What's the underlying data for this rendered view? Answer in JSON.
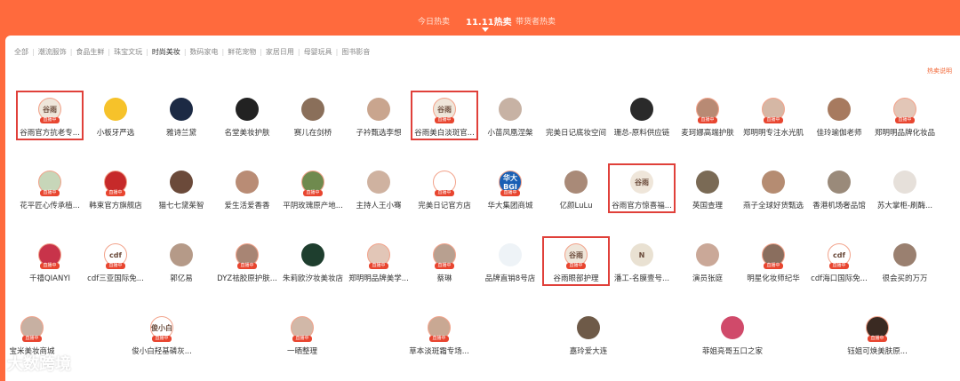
{
  "topnav": {
    "tabs": [
      {
        "label": "今日热卖",
        "active": false
      },
      {
        "label": "11.11热卖",
        "active": true
      },
      {
        "label": "带货者热卖",
        "active": false
      }
    ]
  },
  "categories": [
    {
      "label": "全部",
      "active": false
    },
    {
      "label": "潮流服饰",
      "active": false
    },
    {
      "label": "食品生鲜",
      "active": false
    },
    {
      "label": "珠宝文玩",
      "active": false
    },
    {
      "label": "时尚美妆",
      "active": true
    },
    {
      "label": "数码家电",
      "active": false
    },
    {
      "label": "鲜花宠物",
      "active": false
    },
    {
      "label": "家居日用",
      "active": false
    },
    {
      "label": "母婴玩具",
      "active": false
    },
    {
      "label": "图书影音",
      "active": false
    }
  ],
  "hint": "热卖说明",
  "live_badge": "直播中",
  "watermark": "大数跨境",
  "rows": [
    [
      {
        "name": "谷雨官方抗老专...",
        "avatar": "谷雨",
        "live": true,
        "color": "#efe6da",
        "highlight": true
      },
      {
        "name": "小板牙严选",
        "avatar": "",
        "live": false,
        "color": "#f6c22a"
      },
      {
        "name": "雅诗兰黛",
        "avatar": "",
        "live": false,
        "color": "#1c2a44"
      },
      {
        "name": "名堂美妆护肤",
        "avatar": "",
        "live": false,
        "color": "#222"
      },
      {
        "name": "赛儿在剑桥",
        "avatar": "",
        "live": false,
        "color": "#8a6f5a"
      },
      {
        "name": "子衿甄选李想",
        "avatar": "",
        "live": false,
        "color": "#c9a58e"
      },
      {
        "name": "谷雨美白淡斑官...",
        "avatar": "谷雨",
        "live": true,
        "color": "#efe6da",
        "highlight": true
      },
      {
        "name": "小苗凤凰涅槃",
        "avatar": "",
        "live": false,
        "color": "#c7b2a4"
      },
      {
        "name": "完美日记底妆空间",
        "avatar": "",
        "live": false,
        "color": "#fff"
      },
      {
        "name": "珊总-原料供应链",
        "avatar": "",
        "live": false,
        "color": "#2a2a2a"
      },
      {
        "name": "麦珂娜高端护肤",
        "avatar": "",
        "live": true,
        "color": "#b88a74"
      },
      {
        "name": "郑明明专注水光肌",
        "avatar": "",
        "live": true,
        "color": "#d5b7a5"
      },
      {
        "name": "佳玲瑜伽老师",
        "avatar": "",
        "live": false,
        "color": "#a77a5f"
      },
      {
        "name": "郑明明品牌化妆品",
        "avatar": "",
        "live": true,
        "color": "#e2c6b7"
      }
    ],
    [
      {
        "name": "花平匠心传承植...",
        "avatar": "",
        "live": true,
        "color": "#c7d6b9"
      },
      {
        "name": "韩束官方旗舰店",
        "avatar": "",
        "live": true,
        "color": "#c62a2a"
      },
      {
        "name": "猫七七黛茱智",
        "avatar": "",
        "live": false,
        "color": "#6b4a3a"
      },
      {
        "name": "爱生活爱香香",
        "avatar": "",
        "live": false,
        "color": "#b98c75"
      },
      {
        "name": "平阴玫瑰原产地...",
        "avatar": "",
        "live": true,
        "color": "#6f8a4e"
      },
      {
        "name": "主持人王小骞",
        "avatar": "",
        "live": false,
        "color": "#cfb2a0"
      },
      {
        "name": "完美日记官方店",
        "avatar": "",
        "live": true,
        "color": "#fff"
      },
      {
        "name": "华大集团商城",
        "avatar": "华大BGI",
        "live": true,
        "color": "#1a5fb4"
      },
      {
        "name": "亿颜LuLu",
        "avatar": "",
        "live": false,
        "color": "#a98a78"
      },
      {
        "name": "谷雨官方惊喜福...",
        "avatar": "谷雨",
        "live": false,
        "color": "#efe6da",
        "highlight": true
      },
      {
        "name": "英国查理",
        "avatar": "",
        "live": false,
        "color": "#7a6a55"
      },
      {
        "name": "燕子全球好货甄选",
        "avatar": "",
        "live": false,
        "color": "#b58c72"
      },
      {
        "name": "香港机场奢品馆",
        "avatar": "",
        "live": false,
        "color": "#9a8a7a"
      },
      {
        "name": "苏大掌柜-刷酶...",
        "avatar": "",
        "live": false,
        "color": "#e6e0da"
      }
    ],
    [
      {
        "name": "千禧QIANYI",
        "avatar": "",
        "live": true,
        "color": "#c8334a"
      },
      {
        "name": "cdf三亚国际免...",
        "avatar": "cdf",
        "live": true,
        "color": "#fff"
      },
      {
        "name": "郭亿易",
        "avatar": "",
        "live": false,
        "color": "#b59a88"
      },
      {
        "name": "DYZ祛胶原护肤...",
        "avatar": "",
        "live": true,
        "color": "#a88574"
      },
      {
        "name": "朱莉欧汐妆美妆店",
        "avatar": "",
        "live": false,
        "color": "#1e3e2e"
      },
      {
        "name": "郑明明品牌美学...",
        "avatar": "",
        "live": true,
        "color": "#e2c6b7"
      },
      {
        "name": "蔡琳",
        "avatar": "",
        "live": true,
        "color": "#b8a090"
      },
      {
        "name": "品牌直销8号店",
        "avatar": "",
        "live": false,
        "color": "#eef3f7"
      },
      {
        "name": "谷雨眼部护理",
        "avatar": "谷雨",
        "live": true,
        "color": "#efe6da",
        "highlight": true
      },
      {
        "name": "潘工-名膜壹号...",
        "avatar": "N",
        "live": false,
        "color": "#e9e1d2"
      },
      {
        "name": "演员张庭",
        "avatar": "",
        "live": false,
        "color": "#caa898"
      },
      {
        "name": "明星化妆师纪华",
        "avatar": "",
        "live": true,
        "color": "#8a6e5e"
      },
      {
        "name": "cdf海口国际免...",
        "avatar": "cdf",
        "live": true,
        "color": "#fff"
      },
      {
        "name": "很会买的万万",
        "avatar": "",
        "live": false,
        "color": "#9a8070"
      }
    ],
    [
      {
        "name": "宝米美妆商城",
        "avatar": "",
        "live": true,
        "color": "#c7b0a2"
      },
      {
        "name": "俊小白羟基磷灰...",
        "avatar": "俊小白",
        "live": true,
        "color": "#fff"
      },
      {
        "name": "一晒整理",
        "avatar": "",
        "live": true,
        "color": "#d1b8a8"
      },
      {
        "name": "草本淡斑霜专场...",
        "avatar": "",
        "live": true,
        "color": "#c9a893"
      },
      {
        "name": "嘉玲爱大连",
        "avatar": "",
        "live": false,
        "color": "#6e5a48"
      },
      {
        "name": "菲姐亮哥五口之家",
        "avatar": "",
        "live": false,
        "color": "#d04a6a"
      },
      {
        "name": "钰姐可焕美肤原...",
        "avatar": "",
        "live": true,
        "color": "#3a2a22"
      }
    ]
  ]
}
